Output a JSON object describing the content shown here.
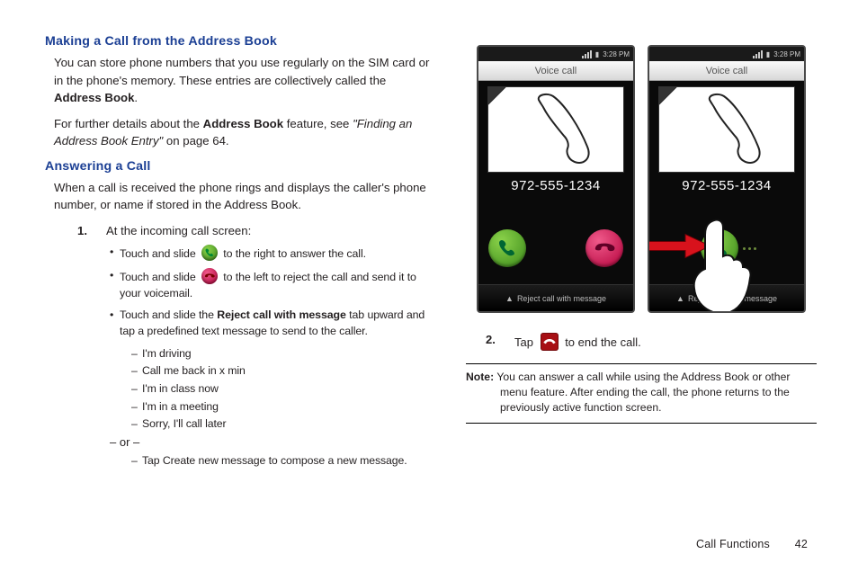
{
  "left": {
    "h1": "Making a Call from the Address Book",
    "p1a": "You can store phone numbers that you use regularly on the SIM card or in the phone's memory. These entries are collectively called the ",
    "p1b_bold": "Address Book",
    "p1c": ".",
    "p2a": "For further details about the ",
    "p2b_bold": "Address Book",
    "p2c": " feature, see ",
    "p2d_italic": "\"Finding an Address Book Entry\"",
    "p2e": " on page 64.",
    "h2": "Answering a Call",
    "p3": "When a call is received the phone rings and displays the caller's phone number, or name if stored in the Address Book.",
    "step1_num": "1.",
    "step1_text": "At the incoming call screen:",
    "b1a": "Touch and slide ",
    "b1b": " to the right to answer the call.",
    "b2a": "Touch and slide ",
    "b2b": " to the left to reject the call and send it to your voicemail.",
    "b3a": "Touch and slide the ",
    "b3b_bold": "Reject call with message",
    "b3c": " tab upward and tap a predefined text message to send to the caller.",
    "dash1": "I'm driving",
    "dash2": "Call me back in x min",
    "dash3": "I'm in class now",
    "dash4": "I'm in a meeting",
    "dash5": "Sorry, I'll call later",
    "or": "– or –",
    "dash6a": "Tap ",
    "dash6b_bold": "Create new message",
    "dash6c": " to compose a new message."
  },
  "phone": {
    "time": "3:28 PM",
    "voice": "Voice call",
    "number": "972-555-1234",
    "reject": "Reject call with message"
  },
  "right": {
    "step2_num": "2.",
    "step2a": "Tap ",
    "step2b": " to end the call.",
    "note_label": "Note:",
    "note_body": " You can answer a call while using the Address Book or other menu feature. After ending the call, the phone returns to the previously active function screen."
  },
  "footer": {
    "section": "Call Functions",
    "page": "42"
  }
}
